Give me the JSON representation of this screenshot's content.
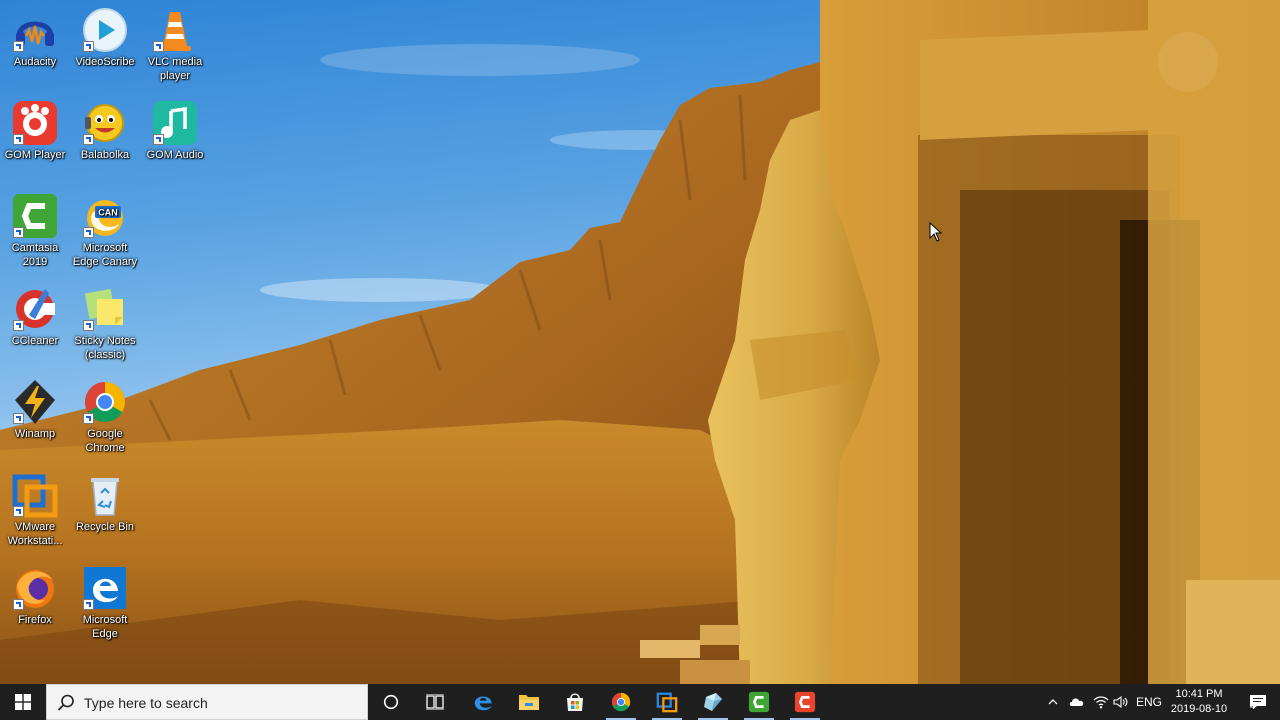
{
  "desktop": {
    "icons": [
      {
        "label": "Audacity"
      },
      {
        "label": "VideoScribe"
      },
      {
        "label": "VLC media player"
      },
      {
        "label": "GOM Player"
      },
      {
        "label": "Balabolka"
      },
      {
        "label": "GOM Audio"
      },
      {
        "label": "Camtasia 2019"
      },
      {
        "label": "Microsoft Edge Canary"
      },
      {
        "label": "CCleaner"
      },
      {
        "label": "Sticky Notes (classic)"
      },
      {
        "label": "Winamp"
      },
      {
        "label": "Google Chrome"
      },
      {
        "label": "VMware Workstati..."
      },
      {
        "label": "Recycle Bin"
      },
      {
        "label": "Firefox"
      },
      {
        "label": "Microsoft Edge"
      }
    ],
    "canary_badge": "CAN"
  },
  "taskbar": {
    "search_placeholder": "Type here to search",
    "pinned": [
      {
        "icon": "cortana-icon"
      },
      {
        "icon": "task-view-icon"
      },
      {
        "icon": "edge-icon"
      },
      {
        "icon": "file-explorer-icon"
      },
      {
        "icon": "microsoft-store-icon"
      },
      {
        "icon": "chrome-icon"
      },
      {
        "icon": "vmware-icon"
      },
      {
        "icon": "app-icon"
      },
      {
        "icon": "camtasia-icon"
      },
      {
        "icon": "camtasia-recorder-icon"
      }
    ],
    "tray": {
      "language": "ENG",
      "time": "10:41 PM",
      "date": "2019-08-10",
      "notification_count": "4"
    }
  },
  "colors": {
    "taskbar_bg": "#1f1f1f",
    "search_bg": "#f3f3f3",
    "accent": "#0078d7"
  }
}
